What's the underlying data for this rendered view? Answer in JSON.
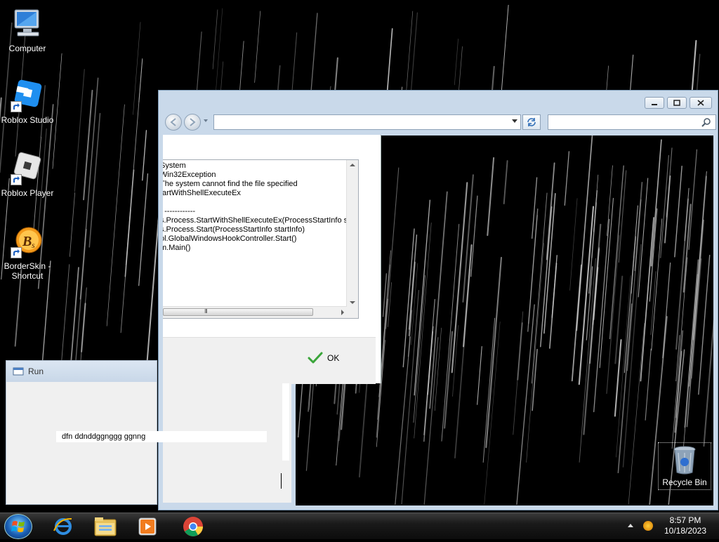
{
  "desktop": {
    "icons": [
      {
        "label": "Computer",
        "icon": "computer-icon"
      },
      {
        "label": "Roblox Studio",
        "icon": "roblox-studio-icon"
      },
      {
        "label": "Roblox Player",
        "icon": "roblox-player-icon"
      },
      {
        "label": "BorderSkin - Shortcut",
        "icon": "borderskin-icon"
      }
    ],
    "recycle_bin": {
      "label": "Recycle Bin",
      "icon": "recycle-bin-icon"
    }
  },
  "explorer": {
    "controls": {
      "minimize": "minimize-icon",
      "maximize": "maximize-icon",
      "close": "close-icon"
    },
    "address": {
      "value": ""
    },
    "search": {
      "placeholder": ""
    }
  },
  "error_dialog": {
    "details_lines": [
      "System",
      "Win32Exception",
      "The system cannot find the file specified",
      "tartWithShellExecuteEx",
      "",
      ": ------------",
      "s.Process.StartWithShellExecuteEx(ProcessStartInfo st",
      "s.Process.Start(ProcessStartInfo startInfo)",
      "ol.GlobalWindowsHookController.Start()",
      "m.Main()"
    ],
    "hscroll_grip": "III",
    "ok_label": "OK"
  },
  "run_dialog": {
    "title": "Run",
    "input_value": "dfn ddnddggnggg ggnng"
  },
  "taskbar": {
    "pinned": [
      "internet-explorer-icon",
      "file-explorer-icon",
      "media-player-icon",
      "chrome-icon"
    ],
    "clock": {
      "time": "8:57 PM",
      "date": "10/18/2023"
    }
  }
}
